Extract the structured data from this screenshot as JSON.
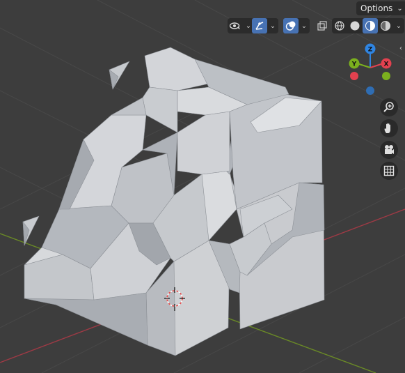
{
  "header": {
    "options_label": "Options",
    "options_caret": "⌄",
    "caret": "⌄"
  },
  "gizmo": {
    "z_label": "Z",
    "y_label": "Y",
    "x_label": "X",
    "colors": {
      "x": "#e2414f",
      "y": "#7bb01e",
      "z": "#2f85e3"
    }
  },
  "side_panel": {
    "toggle": "‹"
  },
  "colors": {
    "background": "#3d3d3d",
    "grid": "#4a4a4a",
    "x_axis_line": "#9e3a45",
    "y_axis_line": "#6a8a26",
    "active_button": "#4772b3",
    "mesh_light": "#d6d8dc",
    "mesh_mid": "#b8bcc2",
    "mesh_dark": "#9ea3aa"
  },
  "icons": {
    "visibility": "eye-icon",
    "gizmo_toggle": "gizmo-icon",
    "overlay_toggle": "overlay-icon",
    "xray": "xray-icon",
    "wireframe": "wireframe-shading-icon",
    "solid": "solid-shading-icon",
    "material": "material-shading-icon",
    "rendered": "rendered-shading-icon",
    "zoom": "zoom-icon",
    "pan": "hand-icon",
    "camera": "camera-icon",
    "ortho": "grid-icon",
    "cursor": "3d-cursor-icon"
  }
}
